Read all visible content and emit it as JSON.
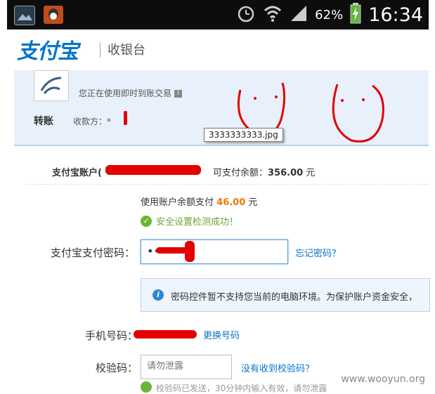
{
  "status_bar": {
    "battery_percent": "62%",
    "time": "16:34",
    "icons": [
      "gallery-icon",
      "qq-icon",
      "alarm-icon",
      "wifi-icon",
      "signal-icon",
      "battery-icon"
    ]
  },
  "header": {
    "logo_text": "支付宝",
    "subtitle": "收银台"
  },
  "order": {
    "using_text": "您正在使用即时到账交易",
    "type_label": "转账",
    "payee_label": "收款方：*",
    "tooltip": "3333333333.jpg"
  },
  "account": {
    "account_label": "支付宝账户(",
    "balance_label": "可支付余额：",
    "balance_value": "356.00",
    "currency": "元"
  },
  "payment": {
    "use_balance_prefix": "使用账户余额支付",
    "use_amount": "46.00",
    "currency": "元",
    "security_ok": "安全设置检测成功！",
    "password_label": "支付宝支付密码：",
    "password_dots": "•••",
    "forgot_password": "忘记密码？",
    "notice": "密码控件暂不支持您当前的电脑环境。为保护账户资金安全，",
    "phone_label": "手机号码：",
    "change_phone": "更换号码",
    "code_label": "校验码：",
    "code_placeholder": "请勿泄露",
    "no_code": "没有收到校验码？",
    "bottom_partial": "校验码已发送，30分钟内输入有效，请勿泄露"
  },
  "watermark": "www.wooyun.org",
  "colors": {
    "brand_blue": "#0a74c9",
    "amount_orange": "#f07800",
    "success_green": "#6bb534",
    "redaction_red": "#e20000"
  }
}
